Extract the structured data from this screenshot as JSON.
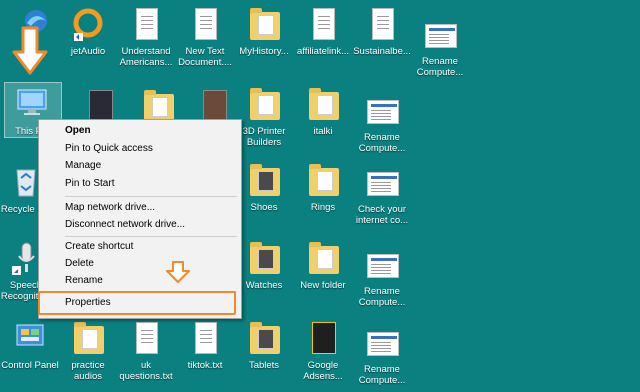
{
  "desktop": {
    "icons": [
      {
        "label": "jetAudio",
        "icon": "jetaudio-icon"
      },
      {
        "label": "Understand Americans...",
        "icon": "text-file-icon"
      },
      {
        "label": "New Text Document....",
        "icon": "text-file-icon"
      },
      {
        "label": "MyHistory...",
        "icon": "folder-icon"
      },
      {
        "label": "affiliatelink...",
        "icon": "text-file-icon"
      },
      {
        "label": "Sustainalbe...",
        "icon": "text-file-icon"
      },
      {
        "label": "Rename Compute...",
        "icon": "screenshot-icon"
      },
      {
        "label": "This PC",
        "icon": "this-pc-icon"
      },
      {
        "label": "3D Printer Builders",
        "icon": "folder-icon"
      },
      {
        "label": "italki",
        "icon": "folder-icon"
      },
      {
        "label": "Rename Compute...",
        "icon": "screenshot-icon"
      },
      {
        "label": "Recycle Bin",
        "icon": "recycle-bin-icon"
      },
      {
        "label": "Shoes",
        "icon": "folder-icon"
      },
      {
        "label": "Rings",
        "icon": "folder-icon"
      },
      {
        "label": "Check your internet co...",
        "icon": "screenshot-icon"
      },
      {
        "label": "Speech Recognition",
        "icon": "microphone-icon"
      },
      {
        "label": "Watches",
        "icon": "folder-icon"
      },
      {
        "label": "New folder",
        "icon": "folder-icon"
      },
      {
        "label": "Rename Compute...",
        "icon": "screenshot-icon"
      },
      {
        "label": "Control Panel",
        "icon": "control-panel-icon"
      },
      {
        "label": "practice audios",
        "icon": "folder-icon"
      },
      {
        "label": "uk questions.txt",
        "icon": "text-file-icon"
      },
      {
        "label": "tiktok.txt",
        "icon": "text-file-icon"
      },
      {
        "label": "Tablets",
        "icon": "folder-icon"
      },
      {
        "label": "Google Adsens...",
        "icon": "book-icon"
      },
      {
        "label": "Rename Compute...",
        "icon": "screenshot-icon"
      }
    ]
  },
  "context_menu": {
    "open": "Open",
    "pin_quick_access": "Pin to Quick access",
    "manage": "Manage",
    "pin_start": "Pin to Start",
    "map_drive": "Map network drive...",
    "disconnect_drive": "Disconnect network drive...",
    "create_shortcut": "Create shortcut",
    "delete": "Delete",
    "rename": "Rename",
    "properties": "Properties"
  },
  "colors": {
    "desktop_bg": "#0a8080",
    "annotation_orange": "#f08a2c"
  }
}
